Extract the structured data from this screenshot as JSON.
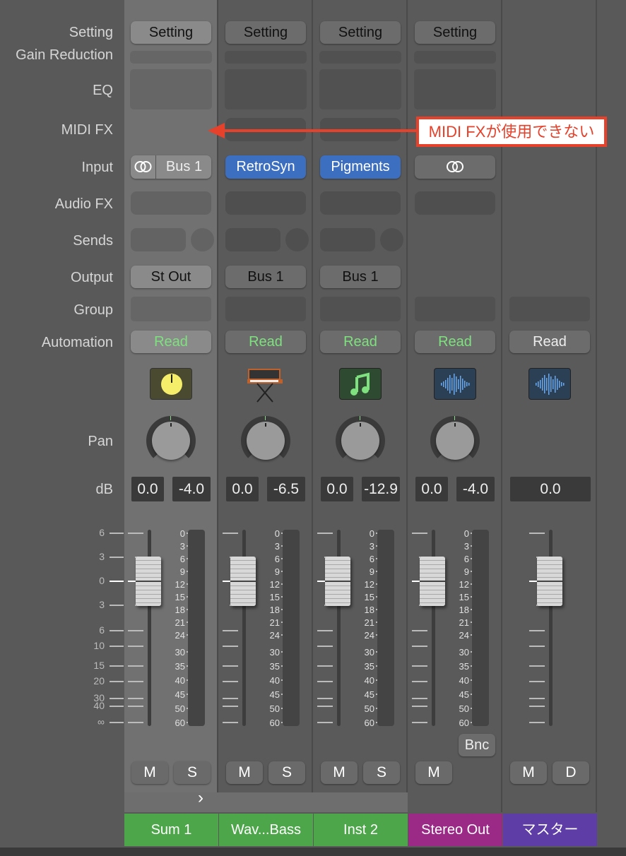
{
  "labels": {
    "setting": "Setting",
    "gain_reduction": "Gain Reduction",
    "eq": "EQ",
    "midi_fx": "MIDI FX",
    "input": "Input",
    "audio_fx": "Audio FX",
    "sends": "Sends",
    "output": "Output",
    "group": "Group",
    "automation": "Automation",
    "pan": "Pan",
    "db": "dB"
  },
  "fader_scale": [
    "6",
    "3",
    "0",
    "3",
    "6",
    "10",
    "15",
    "20",
    "30",
    "40",
    "∞"
  ],
  "meter_scale": [
    "0",
    "3",
    "6",
    "9",
    "12",
    "15",
    "18",
    "21",
    "24",
    "30",
    "35",
    "40",
    "45",
    "50",
    "60"
  ],
  "annotation": {
    "text": "MIDI FXが使用できない",
    "color": "#e5412b"
  },
  "strips": [
    {
      "name": "Sum 1",
      "color": "#4ea64a",
      "selected": true,
      "setting": "Setting",
      "midi_fx": false,
      "input": "Bus 1",
      "input_link": true,
      "input_style": "normal",
      "audio_fx": true,
      "sends": true,
      "output": "St Out",
      "automation": "Read",
      "automation_green": true,
      "icon": "aux-knob-icon",
      "pan": "0.0",
      "gain": "-4.0",
      "meter": true,
      "mute": "M",
      "solo": "S",
      "bnc": null
    },
    {
      "name": "Wav...Bass",
      "color": "#4ea64a",
      "selected": false,
      "setting": "Setting",
      "midi_fx": true,
      "input": "RetroSyn",
      "input_link": false,
      "input_style": "blue",
      "audio_fx": true,
      "sends": true,
      "output": "Bus 1",
      "automation": "Read",
      "automation_green": true,
      "icon": "synthesizer-icon",
      "pan": "0.0",
      "gain": "-6.5",
      "meter": true,
      "mute": "M",
      "solo": "S",
      "bnc": null
    },
    {
      "name": "Inst 2",
      "color": "#4ea64a",
      "selected": false,
      "setting": "Setting",
      "midi_fx": true,
      "input": "Pigments",
      "input_link": false,
      "input_style": "blue",
      "audio_fx": true,
      "sends": true,
      "output": "Bus 1",
      "automation": "Read",
      "automation_green": true,
      "icon": "music-note-icon",
      "pan": "0.0",
      "gain": "-12.9",
      "meter": true,
      "mute": "M",
      "solo": "S",
      "bnc": null
    },
    {
      "name": "Stereo Out",
      "color": "#9b2a86",
      "selected": false,
      "setting": "Setting",
      "midi_fx": false,
      "input": "",
      "input_link": true,
      "input_style": "normal",
      "audio_fx": true,
      "sends": false,
      "output": null,
      "automation": "Read",
      "automation_green": true,
      "icon": "waveform-icon",
      "pan": "0.0",
      "gain": "-4.0",
      "meter": true,
      "mute": "M",
      "solo": null,
      "bnc": "Bnc"
    },
    {
      "name": "マスター",
      "color": "#5e3ea6",
      "selected": false,
      "setting": null,
      "midi_fx": false,
      "input": null,
      "input_link": false,
      "input_style": "none",
      "audio_fx": false,
      "sends": false,
      "output": null,
      "automation": "Read",
      "automation_green": false,
      "icon": "waveform-icon",
      "pan": null,
      "gain": "0.0",
      "meter": false,
      "mute": "M",
      "solo": "D",
      "bnc": null
    }
  ],
  "expand_label": "›"
}
